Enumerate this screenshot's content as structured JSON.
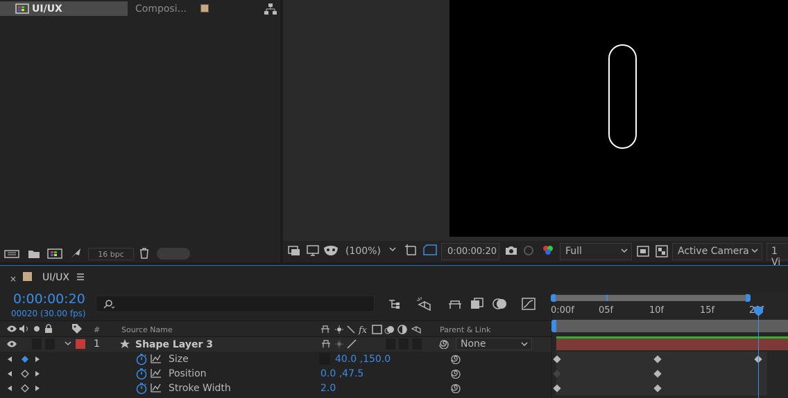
{
  "project": {
    "item_name": "UI/UX",
    "item_type": "Composi...",
    "bpc": "16 bpc"
  },
  "viewer": {
    "zoom": "(100%)",
    "timecode": "0:00:00:20",
    "resolution": "Full",
    "camera": "Active Camera",
    "views": "1 Vi"
  },
  "timeline": {
    "comp_name": "UI/UX",
    "current_time": "0:00:00:20",
    "frame_info": "00020 (30.00 fps)",
    "columns": {
      "number": "#",
      "source_name": "Source Name",
      "parent": "Parent & Link"
    },
    "layer": {
      "number": "1",
      "name": "Shape Layer 3",
      "parent": "None",
      "label_color": "#c23a3a"
    },
    "properties": [
      {
        "name": "Size",
        "value": "40.0 ,150.0"
      },
      {
        "name": "Position",
        "value": "0.0 ,47.5"
      },
      {
        "name": "Stroke Width",
        "value": "2.0"
      }
    ],
    "ruler": [
      "0:00f",
      "05f",
      "10f",
      "15f",
      "20f"
    ]
  },
  "colors": {
    "accent": "#3a8ee6",
    "layer_bar": "#7d3838",
    "label": "#c23a3a"
  }
}
